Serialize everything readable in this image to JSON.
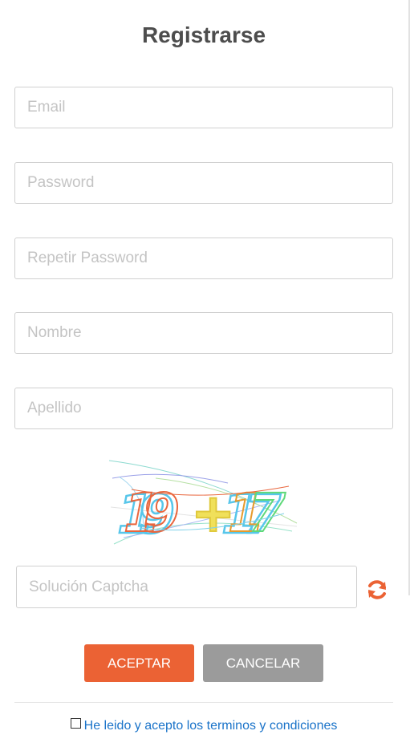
{
  "form": {
    "title": "Registrarse",
    "email": {
      "placeholder": "Email",
      "value": ""
    },
    "password": {
      "placeholder": "Password",
      "value": ""
    },
    "repeat_password": {
      "placeholder": "Repetir Password",
      "value": ""
    },
    "first_name": {
      "placeholder": "Nombre",
      "value": ""
    },
    "last_name": {
      "placeholder": "Apellido",
      "value": ""
    },
    "captcha": {
      "image_text": "19+17",
      "input_placeholder": "Solución Captcha",
      "input_value": "",
      "refresh_icon": "refresh-icon",
      "refresh_color": "#eb6234"
    },
    "actions": {
      "accept_label": "ACEPTAR",
      "cancel_label": "CANCELAR",
      "accept_color": "#eb6234",
      "cancel_color": "#9b9b9b"
    },
    "terms": {
      "checked": false,
      "label": "He leido y acepto los terminos y condiciones",
      "link_color": "#1a73c9"
    }
  }
}
